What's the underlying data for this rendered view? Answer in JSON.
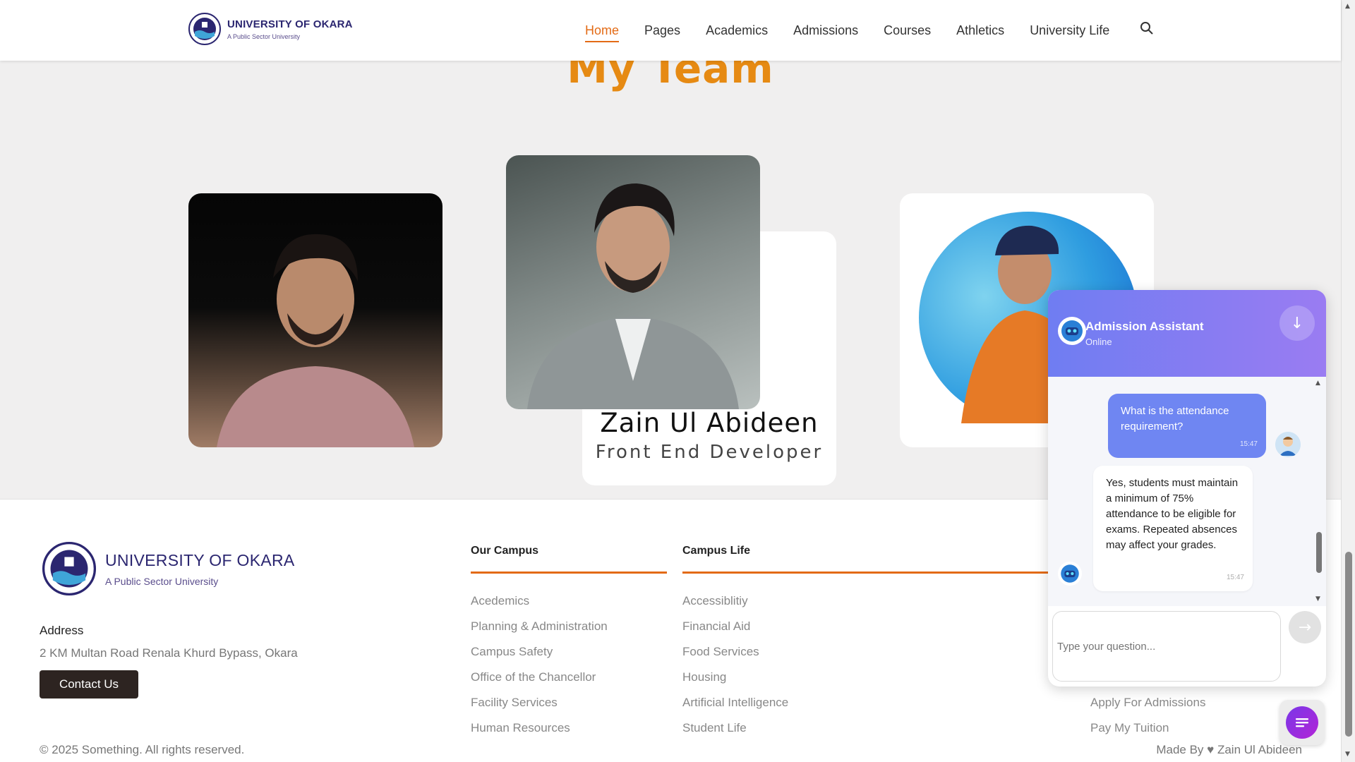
{
  "header": {
    "logo_title": "UNIVERSITY OF OKARA",
    "logo_subtitle": "A Public Sector University",
    "nav": [
      "Home",
      "Pages",
      "Academics",
      "Admissions",
      "Courses",
      "Athletics",
      "University Life"
    ],
    "active_nav": "Home",
    "accent_color": "#e36b16"
  },
  "team": {
    "title": "My Team",
    "featured_member": {
      "name": "Zain Ul Abideen",
      "role": "Front End Developer"
    }
  },
  "footer": {
    "logo_title": "UNIVERSITY OF OKARA",
    "logo_subtitle": "A Public Sector University",
    "address_label": "Address",
    "address": "2 KM Multan Road Renala Khurd Bypass, Okara",
    "contact_button": "Contact Us",
    "columns": [
      {
        "heading": "Our Campus",
        "items": [
          "Acedemics",
          "Planning & Administration",
          "Campus Safety",
          "Office of the Chancellor",
          "Facility Services",
          "Human Resources"
        ]
      },
      {
        "heading": "Campus Life",
        "items": [
          "Accessiblitiy",
          "Financial Aid",
          "Food Services",
          "Housing",
          "Artificial Intelligence",
          "Student Life"
        ]
      }
    ],
    "right_links": [
      "Apply For Admissions",
      "Pay My Tuition"
    ],
    "copyright": "© 2025 Something. All rights reserved.",
    "made_by": "Made By ♥ Zain Ul Abideen"
  },
  "chat": {
    "title": "Admission Assistant",
    "status": "Online",
    "minimize_icon": "↓",
    "messages": [
      {
        "from": "user",
        "text": "What is the attendance requirement?",
        "time": "15:47"
      },
      {
        "from": "bot",
        "text": "Yes, students must maintain a minimum of 75% attendance to be eligible for exams. Repeated absences may affect your grades.",
        "time": "15:47"
      }
    ],
    "input_placeholder": "Type your question...",
    "send_icon": "→",
    "header_gradient": [
      "#6f7df2",
      "#9a7cf2"
    ]
  }
}
